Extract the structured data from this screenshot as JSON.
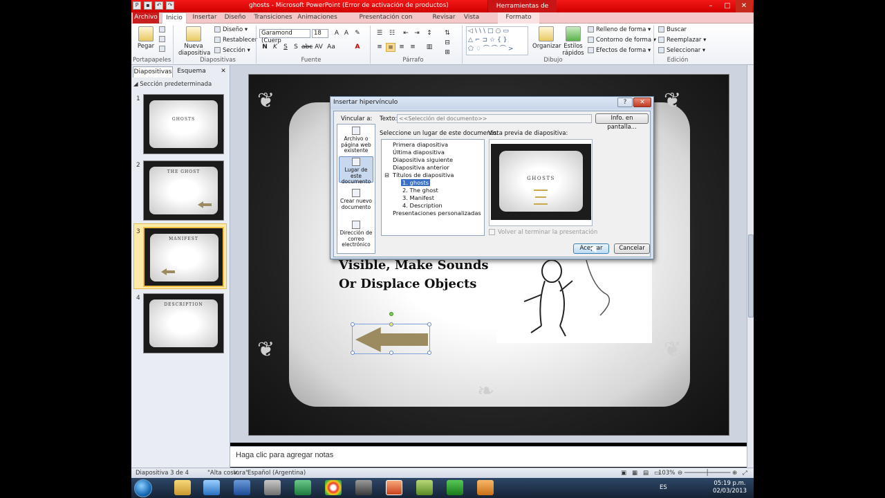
{
  "window": {
    "title": "ghosts - Microsoft PowerPoint (Error de activación de productos)",
    "contextual_tab": "Herramientas de dibujo",
    "min": "–",
    "max": "□",
    "close": "✕"
  },
  "tabs": [
    "Archivo",
    "Inicio",
    "Insertar",
    "Diseño",
    "Transiciones",
    "Animaciones",
    "Presentación con diapositivas",
    "Revisar",
    "Vista",
    "Formato"
  ],
  "ribbon": {
    "clipboard": {
      "paste": "Pegar",
      "label": "Portapapeles"
    },
    "slides": {
      "new_slide": "Nueva diapositiva",
      "layout": "Diseño",
      "reset": "Restablecer",
      "section": "Sección",
      "label": "Diapositivas"
    },
    "font": {
      "name": "Garamond (Cuerp",
      "size": "18",
      "bold": "N",
      "italic": "K",
      "underline": "S",
      "strike": "S",
      "label": "Fuente"
    },
    "paragraph": {
      "label": "Párrafo"
    },
    "drawing": {
      "arrange": "Organizar",
      "quick_styles": "Estilos rápidos",
      "fill": "Relleno de forma",
      "outline": "Contorno de forma",
      "effects": "Efectos de forma",
      "label": "Dibujo"
    },
    "editing": {
      "find": "Buscar",
      "replace": "Reemplazar",
      "select": "Seleccionar",
      "label": "Edición"
    }
  },
  "left_panel": {
    "tabs": [
      "Diapositivas",
      "Esquema"
    ],
    "close": "✕",
    "section": "Sección predeterminada",
    "thumbnails": [
      {
        "num": "1",
        "title": "GHOSTS"
      },
      {
        "num": "2",
        "title": "THE GHOST"
      },
      {
        "num": "3",
        "title": "MANIFEST"
      },
      {
        "num": "4",
        "title": "DESCRIPTION"
      }
    ]
  },
  "slide": {
    "text": "Visible, Make Sounds Or Displace Objects"
  },
  "notes": {
    "placeholder": "Haga clic para agregar notas"
  },
  "status": {
    "slide": "Diapositiva 3 de 4",
    "theme": "\"Alta costura\"",
    "language": "Español (Argentina)",
    "zoom": "103%"
  },
  "taskbar": {
    "lang": "ES",
    "time": "05:19 p.m.",
    "date": "02/03/2013"
  },
  "dialog": {
    "title": "Insertar hipervínculo",
    "help": "?",
    "close": "✕",
    "link_to": "Vincular a:",
    "text_label": "Texto:",
    "text_value": "<<Selección del documento>>",
    "screentip": "Info. en pantalla...",
    "options": [
      "Archivo o página web existente",
      "Lugar de este documento",
      "Crear nuevo documento",
      "Dirección de correo electrónico"
    ],
    "place_label": "Seleccione un lugar de este documento:",
    "tree": [
      "Primera diapositiva",
      "Última diapositiva",
      "Diapositiva siguiente",
      "Diapositiva anterior",
      "Títulos de diapositiva",
      "1. ghosts",
      "2. The ghost",
      "3. Manifest",
      "4. Description",
      "Presentaciones personalizadas"
    ],
    "preview_label": "Vista previa de diapositiva:",
    "preview_title": "GHOSTS",
    "return_label": "Volver al terminar la presentación",
    "ok": "Aceptar",
    "cancel": "Cancelar"
  }
}
